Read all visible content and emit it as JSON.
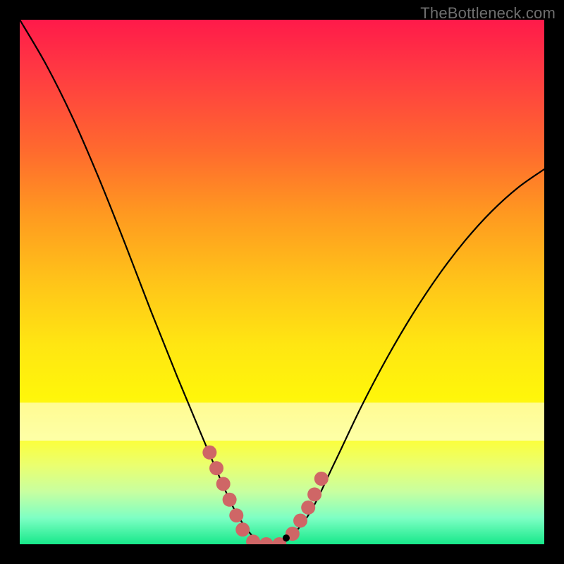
{
  "watermark": "TheBottleneck.com",
  "chart_data": {
    "type": "line",
    "title": "",
    "xlabel": "",
    "ylabel": "",
    "xlim": [
      0,
      1
    ],
    "ylim": [
      0,
      1
    ],
    "background_gradient_top": "#ff1a4a",
    "background_gradient_bottom": "#17e88a",
    "white_band": {
      "y_from": 0.197,
      "y_to": 0.27,
      "opacity": 0.55
    },
    "black_curve": {
      "x": [
        0.0,
        0.05,
        0.1,
        0.15,
        0.2,
        0.25,
        0.3,
        0.35,
        0.4,
        0.425,
        0.45,
        0.475,
        0.5,
        0.55,
        0.6,
        0.65,
        0.7,
        0.75,
        0.8,
        0.85,
        0.9,
        0.95,
        1.0
      ],
      "y": [
        1.0,
        0.915,
        0.815,
        0.7,
        0.575,
        0.445,
        0.32,
        0.2,
        0.085,
        0.04,
        0.01,
        0.0,
        0.0,
        0.055,
        0.155,
        0.26,
        0.355,
        0.44,
        0.515,
        0.58,
        0.635,
        0.68,
        0.715
      ]
    },
    "marker_series": [
      {
        "name": "pink-left",
        "color": "#cf6666",
        "radius_px": 10,
        "points_xy": [
          [
            0.362,
            0.175
          ],
          [
            0.375,
            0.145
          ],
          [
            0.388,
            0.115
          ],
          [
            0.4,
            0.085
          ],
          [
            0.413,
            0.055
          ],
          [
            0.425,
            0.028
          ]
        ]
      },
      {
        "name": "pink-bottom",
        "color": "#cf6666",
        "radius_px": 10,
        "points_xy": [
          [
            0.445,
            0.005
          ],
          [
            0.47,
            0.0
          ],
          [
            0.495,
            0.0
          ]
        ]
      },
      {
        "name": "pink-right",
        "color": "#cf6666",
        "radius_px": 10,
        "points_xy": [
          [
            0.52,
            0.02
          ],
          [
            0.535,
            0.045
          ],
          [
            0.55,
            0.07
          ],
          [
            0.562,
            0.095
          ],
          [
            0.575,
            0.125
          ]
        ]
      }
    ],
    "black_dot": {
      "x": 0.508,
      "y": 0.012,
      "radius_px": 5
    }
  }
}
